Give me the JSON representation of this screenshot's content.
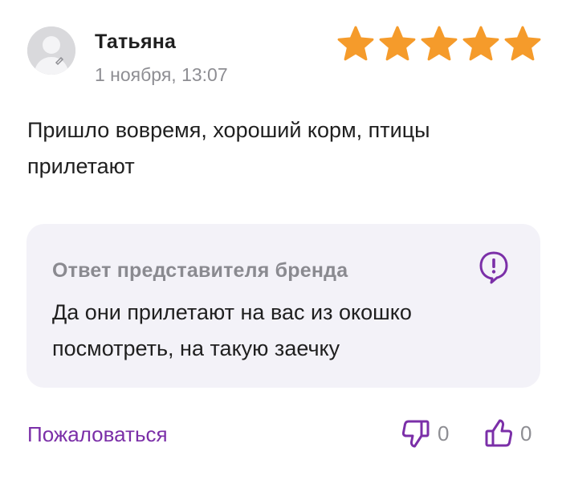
{
  "review": {
    "author": "Татьяна",
    "date": "1 ноября, 13:07",
    "rating": 5,
    "rating_max": 5,
    "text": "Пришло вовремя, хороший корм, птицы прилетают"
  },
  "brand_reply": {
    "title": "Ответ представителя бренда",
    "text": "Да они прилетают на вас из окошко посмотреть, на такую заечку"
  },
  "actions": {
    "report_label": "Пожаловаться",
    "dislike_count": "0",
    "like_count": "0"
  },
  "colors": {
    "star": "#f59b2b",
    "accent": "#7b2fa8",
    "muted_text": "#8e8e93",
    "reply_background": "#f3f2f8"
  },
  "icons": {
    "avatar": "user-avatar-placeholder",
    "star": "star-icon",
    "reply": "exclamation-speech-bubble-icon",
    "dislike": "thumbs-down-icon",
    "like": "thumbs-up-icon"
  }
}
